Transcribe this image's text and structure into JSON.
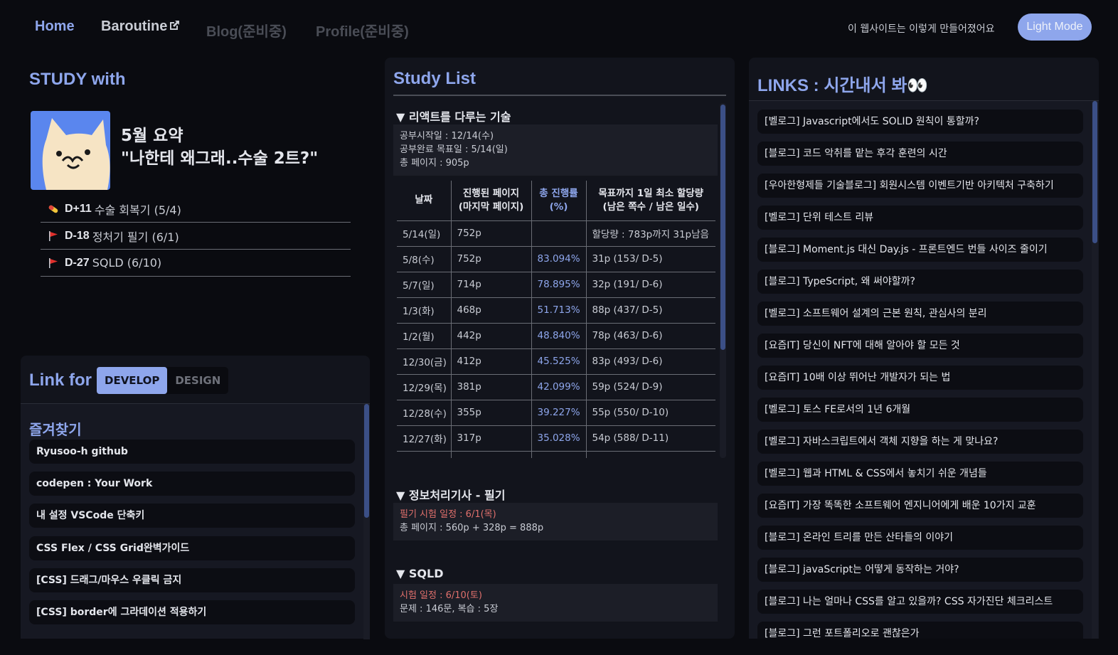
{
  "nav": {
    "home": "Home",
    "baroutine": "Baroutine",
    "blog": "Blog(준비중)",
    "profile": "Profile(준비중)",
    "made_link": "이 웹사이트는 이렇게 만들어졌어요",
    "mode_button": "Light Mode"
  },
  "study_with": {
    "title": "STUDY with",
    "summary_line1": "5월 요약",
    "summary_line2": "\"나한테 왜그래..수술 2트?\"",
    "ddays": [
      {
        "icon": "pill-icon",
        "code": "D+11",
        "text": "수술 회복기 (5/4)"
      },
      {
        "icon": "flag-icon",
        "code": "D-18",
        "text": "정처기 필기 (6/1)"
      },
      {
        "icon": "flag-icon",
        "code": "D-27",
        "text": "SQLD (6/10)"
      }
    ]
  },
  "link_for": {
    "title": "Link for",
    "tabs": [
      "DEVELOP",
      "DESIGN"
    ],
    "active_tab": "DEVELOP",
    "bookmarks_title": "즐겨찾기",
    "bookmarks": [
      "Ryusoo-h github",
      "codepen : Your Work",
      "내 설정 VSCode 단축키",
      "CSS Flex / CSS Grid완벽가이드",
      "[CSS] 드래그/마우스 우클릭 금지",
      "[CSS] border에 그라데이션 적용하기"
    ]
  },
  "study_list": {
    "title": "Study List",
    "sections": [
      {
        "head": "▼ 리액트를 다루는 기술",
        "info": [
          "공부시작일 : 12/14(수)",
          "공부완료 목표일 : 5/14(일)",
          "총 페이지 : 905p"
        ]
      },
      {
        "head": "▼ 정보처리기사 - 필기",
        "info_red": "필기 시험 일정 : 6/1(목)",
        "info": [
          "총 페이지 : 560p + 328p = 888p"
        ]
      },
      {
        "head": "▼ SQLD",
        "info_red": "시험 일정 : 6/10(토)",
        "info": [
          "문제 : 146문, 복습 : 5장"
        ]
      }
    ],
    "table": {
      "headers": [
        "날짜",
        "진행된 페이지\n(마지막 페이지)",
        "총 진행률\n(%)",
        "목표까지 1일 최소 할당량\n(남은 쪽수 / 남은 일수)"
      ],
      "rows": [
        [
          "5/14(일)",
          "752p",
          "",
          "할당량 : 783p까지 31p남음"
        ],
        [
          "5/8(수)",
          "752p",
          "83.094%",
          "31p (153/ D-5)"
        ],
        [
          "5/7(일)",
          "714p",
          "78.895%",
          "32p (191/ D-6)"
        ],
        [
          "1/3(화)",
          "468p",
          "51.713%",
          "88p (437/ D-5)"
        ],
        [
          "1/2(월)",
          "442p",
          "48.840%",
          "78p (463/ D-6)"
        ],
        [
          "12/30(금)",
          "412p",
          "45.525%",
          "83p (493/ D-6)"
        ],
        [
          "12/29(목)",
          "381p",
          "42.099%",
          "59p (524/ D-9)"
        ],
        [
          "12/28(수)",
          "355p",
          "39.227%",
          "55p (550/ D-10)"
        ],
        [
          "12/27(화)",
          "317p",
          "35.028%",
          "54p (588/ D-11)"
        ],
        [
          "",
          "",
          "",
          ""
        ]
      ]
    }
  },
  "links": {
    "title": "LINKS : 시간내서 봐👀",
    "items": [
      "[벨로그] Javascript에서도 SOLID 원칙이 통할까?",
      "[블로그] 코드 악취를 맡는 후각 훈련의 시간",
      "[우아한형제들 기술블로그] 회원시스템 이벤트기반 아키텍처 구축하기",
      "[벨로그] 단위 테스트 리뷰",
      "[블로그] Moment.js 대신 Day.js - 프론트엔드 번들 사이즈 줄이기",
      "[블로그] TypeScript, 왜 써야할까?",
      "[벨로그] 소프트웨어 설계의 근본 원칙, 관심사의 분리",
      "[요즘IT] 당신이 NFT에 대해 알아야 할 모든 것",
      "[요즘IT] 10배 이상 뛰어난 개발자가 되는 법",
      "[벨로그] 토스 FE로서의 1년 6개월",
      "[벨로그] 자바스크립트에서 객체 지향을 하는 게 맞나요?",
      "[벨로그] 웹과 HTML & CSS에서 놓치기 쉬운 개념들",
      "[요즘IT] 가장 똑똑한 소프트웨어 엔지니어에게 배운 10가지 교훈",
      "[블로그] 온라인 트리를 만든 산타들의 이야기",
      "[블로그] javaScript는 어떻게 동작하는 거야?",
      "[블로그] 나는 얼마나 CSS를 알고 있을까? CSS 자가진단 체크리스트",
      "[블로그] 그런 포트폴리오로 괜찮은가"
    ]
  },
  "colors": {
    "background": "#0a0b10",
    "panel": "#12141c",
    "accent": "#8ea6ec",
    "red": "#e0706c"
  }
}
